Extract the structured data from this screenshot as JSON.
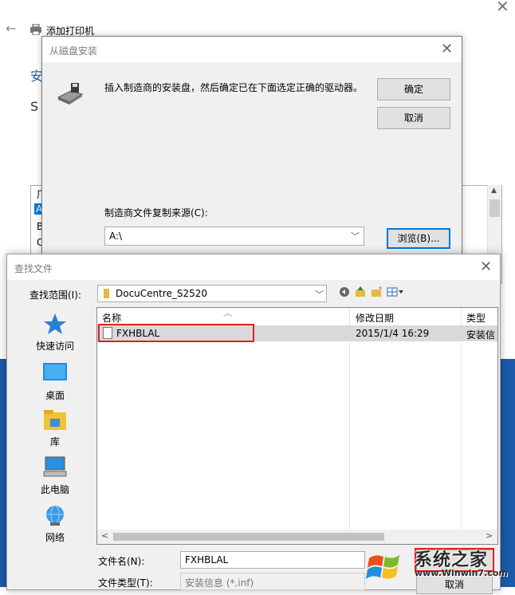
{
  "wizard": {
    "title": "添加打印机",
    "close_glyph": "✕",
    "back_glyph": "←",
    "partial_heading_1": "安",
    "partial_heading_2": "S",
    "list_items": [
      "厂",
      "A",
      "B",
      "C"
    ]
  },
  "disk_dialog": {
    "title": "从磁盘安装",
    "message": "插入制造商的安装盘，然后确定已在下面选定正确的驱动器。",
    "ok_label": "确定",
    "cancel_label": "取消",
    "source_label": "制造商文件复制来源(C):",
    "source_value": "A:\\",
    "browse_label": "浏览(B)..."
  },
  "file_dialog": {
    "title": "查找文件",
    "look_in_label": "查找范围(I):",
    "look_in_value": "DocuCentre_S2520",
    "places": [
      {
        "label": "快速访问",
        "icon": "star-icon"
      },
      {
        "label": "桌面",
        "icon": "desktop-icon"
      },
      {
        "label": "库",
        "icon": "library-icon"
      },
      {
        "label": "此电脑",
        "icon": "computer-icon"
      },
      {
        "label": "网络",
        "icon": "network-icon"
      }
    ],
    "columns": {
      "name": "名称",
      "date": "修改日期",
      "type": "类型"
    },
    "files": [
      {
        "name": "FXHBLAL",
        "date": "2015/1/4 16:29",
        "type": "安装信"
      }
    ],
    "file_name_label": "文件名(N):",
    "file_name_value": "FXHBLAL",
    "file_type_label": "文件类型(T):",
    "file_type_value": "安装信息 (*.inf)",
    "cancel_label": "取消"
  },
  "watermark": {
    "brand": "系统之家",
    "url": "www.Winwin7.com"
  },
  "colors": {
    "highlight_red": "#e02020",
    "accent_blue": "#0078d7",
    "desktop_blue": "#1a5aa8"
  }
}
